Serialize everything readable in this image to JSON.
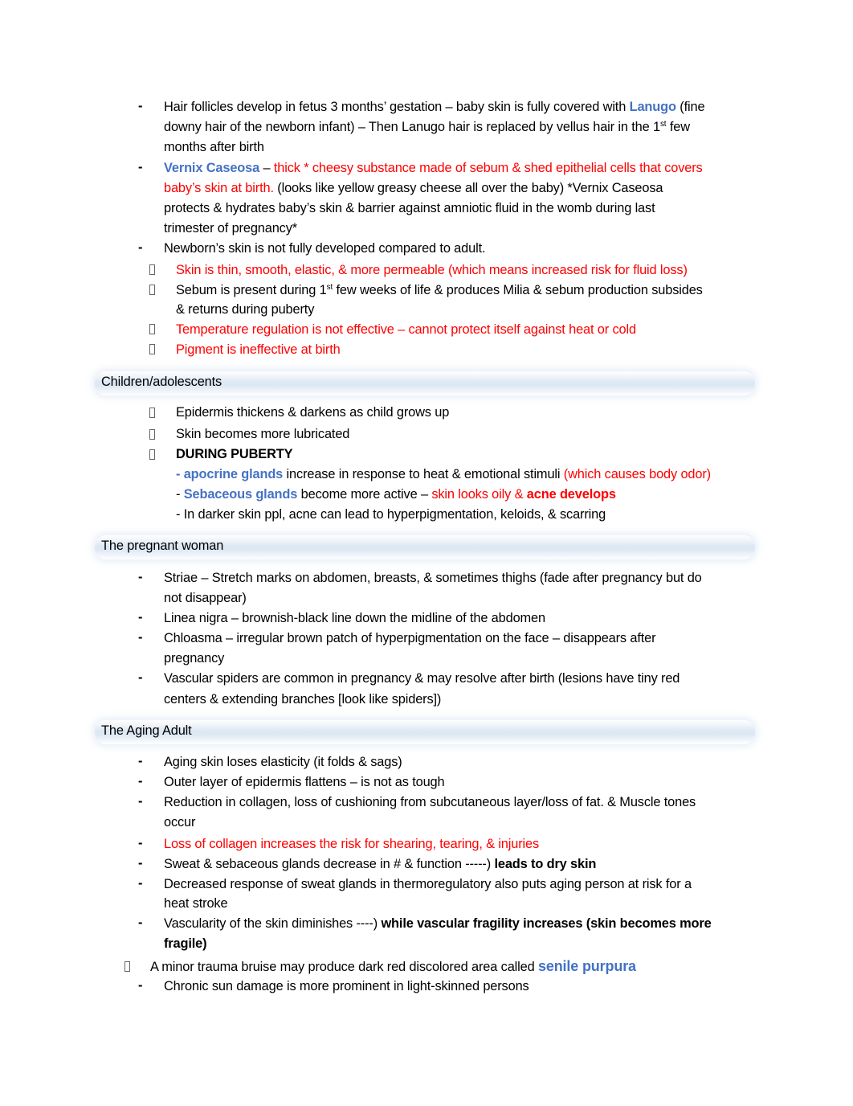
{
  "colors": {
    "blue": "#4472c4",
    "red": "#ff0000",
    "text": "#000000",
    "heading_band": "#dde8f3"
  },
  "newborn": {
    "item1": {
      "l1_a": "Hair follicles develop in fetus 3 months’ gestation – baby skin is fully covered with ",
      "l1_term": "Lanugo",
      "l1_b": " (fine",
      "l2_a": "downy hair of the newborn infant) – Then Lanugo hair is replaced by vellus hair in the 1",
      "l2_sup": "st",
      "l2_b": " few",
      "l3": "months after birth"
    },
    "item2": {
      "term": "Vernix Caseosa",
      "sep": " – ",
      "l1_red": "thick * cheesy substance made of sebum & shed epithelial cells that covers",
      "l2_red": "baby’s skin at birth.",
      "l2_b": " (looks like yellow greasy cheese all over the baby) *Vernix Caseosa",
      "l3": "protects & hydrates baby’s skin & barrier against amniotic fluid in the womb during last",
      "l4": "trimester of pregnancy*"
    },
    "item3": "Newborn’s skin is not fully developed compared to adult.",
    "sub1": "Skin is thin, smooth, elastic, & more permeable (which means increased risk for fluid loss)",
    "sub2": {
      "l1_a": "Sebum is present during 1",
      "l1_sup": "st",
      "l1_b": " few weeks of life & produces Milia & sebum production subsides",
      "l2": "& returns during puberty"
    },
    "sub3": "Temperature regulation is not effective – cannot protect itself against heat or cold",
    "sub4": "Pigment is ineffective at birth"
  },
  "children": {
    "heading": "Children/adolescents",
    "sub1": "Epidermis thickens & darkens as child grows up",
    "sub2": "Skin becomes more lubricated",
    "sub3": "DURING PUBERTY",
    "p1": {
      "term": "- apocrine glands",
      "text": " increase in response to heat & emotional stimuli ",
      "red": "(which causes body odor)"
    },
    "p2": {
      "dash": "- ",
      "term": "Sebaceous glands",
      "text": " become more active – ",
      "red": "skin looks oily & ",
      "redb": "acne develops"
    },
    "p3": "- In darker skin ppl, acne can lead to hyperpigmentation, keloids, & scarring"
  },
  "pregnant": {
    "heading": "The pregnant woman",
    "i1_l1": "Striae – Stretch marks on abdomen, breasts, & sometimes thighs (fade after pregnancy but do",
    "i1_l2": "not disappear)",
    "i2": "Linea nigra – brownish-black line down the midline of the abdomen",
    "i3_l1": "Chloasma – irregular brown patch of hyperpigmentation on the face – disappears after",
    "i3_l2": "pregnancy",
    "i4_l1": "Vascular spiders are common in pregnancy & may resolve after birth (lesions have tiny red",
    "i4_l2": "centers & extending branches [look like spiders])"
  },
  "aging": {
    "heading": "The Aging Adult",
    "i1": "Aging skin loses elasticity (it folds & sags)",
    "i2": "Outer layer of epidermis flattens – is not as tough",
    "i3_l1": "Reduction in collagen, loss of cushioning from subcutaneous layer/loss of fat. & Muscle tones",
    "i3_l2": "occur",
    "i4": "Loss of collagen increases the risk for shearing, tearing, & injuries",
    "i5_a": "Sweat & sebaceous glands decrease in # & function -----) ",
    "i5_b": "leads to dry skin",
    "i6_l1": "Decreased response of sweat glands in thermoregulatory also puts aging person at risk for a",
    "i6_l2": "heat stroke",
    "i7_a": "Vascularity of the skin diminishes ----) ",
    "i7_b": "while vascular fragility increases (skin becomes more",
    "i7_l2": "fragile)",
    "i8_a": "A minor trauma bruise may produce dark red discolored area called ",
    "i8_term": "senile purpura",
    "i9": "Chronic sun damage is more prominent in light-skinned persons"
  },
  "bullets": {
    "dash": "-",
    "box": "missing-glyph-bullet"
  }
}
